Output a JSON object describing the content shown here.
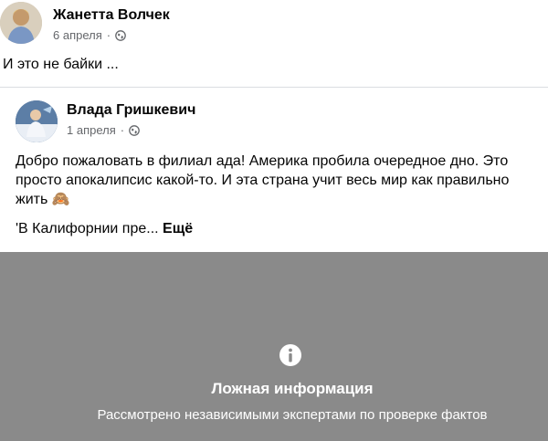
{
  "original_post": {
    "author": "Жанетта Волчек",
    "date": "6 апреля",
    "separator": "·",
    "privacy_icon": "globe-icon",
    "text": "И это не байки ..."
  },
  "shared_post": {
    "author": "Влада Гришкевич",
    "date": "1 апреля",
    "separator": "·",
    "privacy_icon": "globe-icon",
    "text": "Добро пожаловать в филиал ада! Америка пробила очередное дно. Это просто апокалипсис какой-то. И эта страна учит весь мир как правильно жить",
    "emoji": "🙈",
    "excerpt": "'В Калифорнии пре...",
    "see_more": "Ещё"
  },
  "fact_check_overlay": {
    "icon": "info-icon",
    "title": "Ложная информация",
    "subtitle": "Рассмотрено независимыми экспертами по проверке фактов"
  }
}
